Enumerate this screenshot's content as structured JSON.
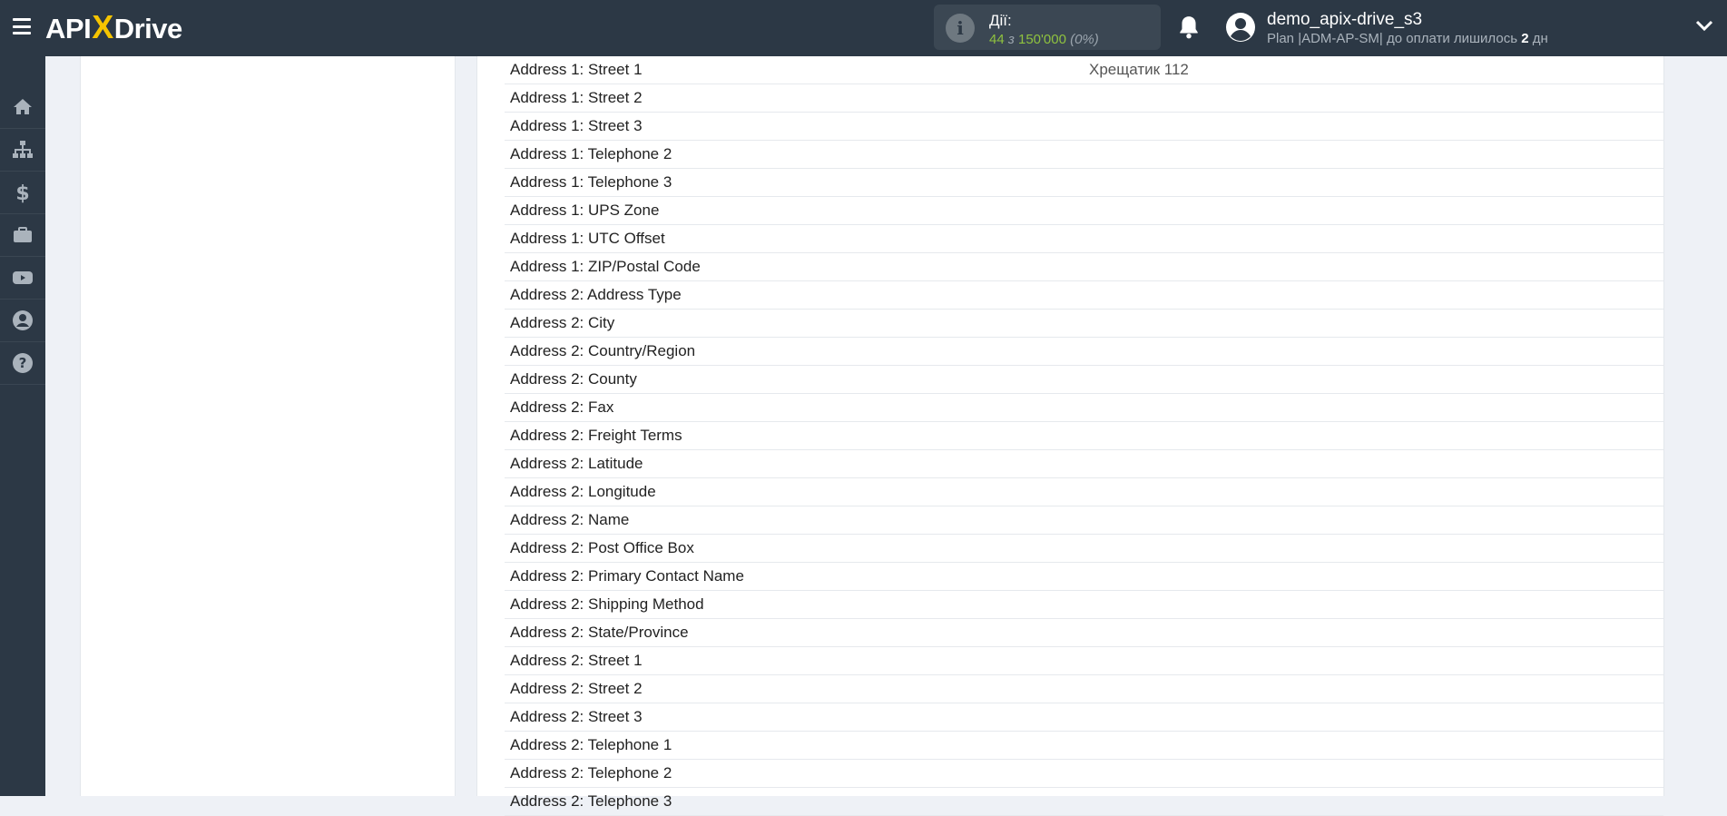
{
  "header": {
    "logo": {
      "api": "API",
      "x": "X",
      "drive": "Drive"
    },
    "actions": {
      "label": "Дії:",
      "used": "44",
      "sep": " з ",
      "total": "150'000",
      "percent": "(0%)"
    },
    "user": {
      "name": "demo_apix-drive_s3",
      "plan_prefix": "Plan |ADM-AP-SM| до оплати лишилось ",
      "days": "2",
      "days_suffix": " дн"
    },
    "colors": {
      "bar": "#2c3845",
      "accent": "#f5c400",
      "green": "#8fc23f"
    }
  },
  "sidebar": {
    "items": [
      {
        "icon": "home-icon"
      },
      {
        "icon": "sitemap-icon"
      },
      {
        "icon": "dollar-icon"
      },
      {
        "icon": "briefcase-icon"
      },
      {
        "icon": "youtube-icon"
      },
      {
        "icon": "user-circle-icon"
      },
      {
        "icon": "question-circle-icon"
      }
    ]
  },
  "fields": [
    {
      "name": "Address 1: Street 1",
      "value": "Хрещатик 112"
    },
    {
      "name": "Address 1: Street 2",
      "value": ""
    },
    {
      "name": "Address 1: Street 3",
      "value": ""
    },
    {
      "name": "Address 1: Telephone 2",
      "value": ""
    },
    {
      "name": "Address 1: Telephone 3",
      "value": ""
    },
    {
      "name": "Address 1: UPS Zone",
      "value": ""
    },
    {
      "name": "Address 1: UTC Offset",
      "value": ""
    },
    {
      "name": "Address 1: ZIP/Postal Code",
      "value": ""
    },
    {
      "name": "Address 2: Address Type",
      "value": ""
    },
    {
      "name": "Address 2: City",
      "value": ""
    },
    {
      "name": "Address 2: Country/Region",
      "value": ""
    },
    {
      "name": "Address 2: County",
      "value": ""
    },
    {
      "name": "Address 2: Fax",
      "value": ""
    },
    {
      "name": "Address 2: Freight Terms",
      "value": ""
    },
    {
      "name": "Address 2: Latitude",
      "value": ""
    },
    {
      "name": "Address 2: Longitude",
      "value": ""
    },
    {
      "name": "Address 2: Name",
      "value": ""
    },
    {
      "name": "Address 2: Post Office Box",
      "value": ""
    },
    {
      "name": "Address 2: Primary Contact Name",
      "value": ""
    },
    {
      "name": "Address 2: Shipping Method",
      "value": ""
    },
    {
      "name": "Address 2: State/Province",
      "value": ""
    },
    {
      "name": "Address 2: Street 1",
      "value": ""
    },
    {
      "name": "Address 2: Street 2",
      "value": ""
    },
    {
      "name": "Address 2: Street 3",
      "value": ""
    },
    {
      "name": "Address 2: Telephone 1",
      "value": ""
    },
    {
      "name": "Address 2: Telephone 2",
      "value": ""
    },
    {
      "name": "Address 2: Telephone 3",
      "value": ""
    }
  ]
}
